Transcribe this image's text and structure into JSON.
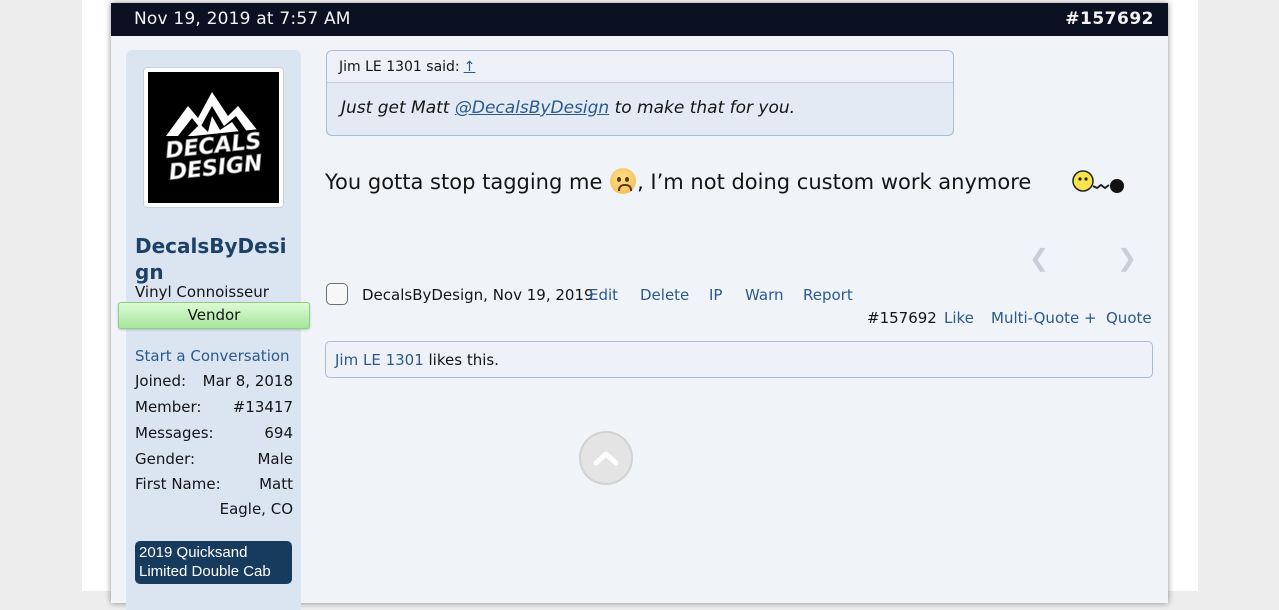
{
  "post": {
    "date": "Nov 19, 2019 at 7:57 AM",
    "number": "#157692"
  },
  "user": {
    "username": "DecalsByDesign",
    "title": "Vinyl Connoisseur",
    "banner": "Vendor",
    "start_conversation": "Start a Conversation",
    "stats": [
      {
        "label": "Joined:",
        "value": "Mar 8, 2018"
      },
      {
        "label": "Member:",
        "value": "#13417"
      },
      {
        "label": "Messages:",
        "value": "694"
      },
      {
        "label": "Gender:",
        "value": "Male"
      },
      {
        "label": "First Name:",
        "value": "Matt"
      }
    ],
    "location": "Eagle, CO",
    "vehicle": "2019 Quicksand Limited Double Cab",
    "avatar_text": [
      "DECALS",
      "DESIGN"
    ]
  },
  "quote": {
    "author": "Jim LE 1301 said:",
    "arrow": "↑",
    "text_before": "Just get Matt ",
    "mention": "@DecalsByDesign",
    "text_after": " to make that for you."
  },
  "message": {
    "text_before": "You gotta stop tagging me ",
    "text_after": ", I’m not doing custom work anymore"
  },
  "actions": {
    "meta": "DecalsByDesign, Nov 19, 2019",
    "edit": "Edit",
    "delete": "Delete",
    "ip": "IP",
    "warn": "Warn",
    "report": "Report",
    "permalink": "#157692",
    "like": "Like",
    "multiquote": "Multi-Quote +",
    "quote": "Quote"
  },
  "likes": {
    "liker": "Jim LE 1301",
    "suffix": " likes this."
  },
  "icons": {
    "prev": "arrow-left-icon",
    "next": "arrow-right-icon",
    "scroll_top": "chevron-up-icon"
  }
}
